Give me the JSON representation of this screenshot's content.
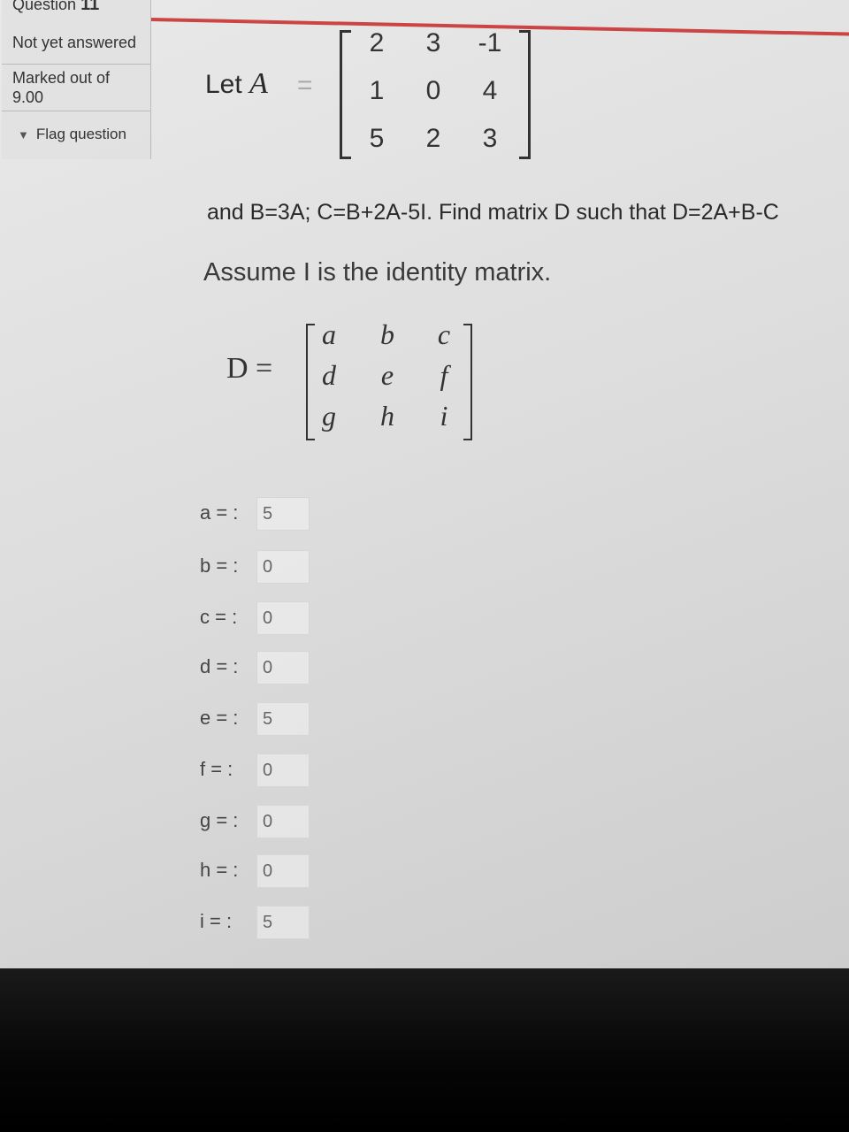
{
  "question_info": {
    "label": "Question",
    "number": "11",
    "status": "Not yet answered",
    "marked_out_of_label": "Marked out of",
    "marked_out_of_value": "9.00",
    "flag_label": "Flag question",
    "flag_icon": "flag-icon"
  },
  "question": {
    "let_text": "Let",
    "matrix_name": "A",
    "equals": "=",
    "matrix_a": [
      [
        "2",
        "3",
        "-1"
      ],
      [
        "1",
        "0",
        "4"
      ],
      [
        "5",
        "2",
        "3"
      ]
    ],
    "problem_text": "and B=3A; C=B+2A-5I. Find matrix D such that D=2A+B-C",
    "assumption": "Assume I is the identity matrix.",
    "d_label": "D =",
    "matrix_d": [
      [
        "a",
        "b",
        "c"
      ],
      [
        "d",
        "e",
        "f"
      ],
      [
        "g",
        "h",
        "i"
      ]
    ]
  },
  "answers": [
    {
      "label": "a = :",
      "value": "5"
    },
    {
      "label": "b = :",
      "value": "0"
    },
    {
      "label": "c = :",
      "value": "0"
    },
    {
      "label": "d = :",
      "value": "0"
    },
    {
      "label": "e = :",
      "value": "5"
    },
    {
      "label": "f = :",
      "value": "0"
    },
    {
      "label": "g = :",
      "value": "0"
    },
    {
      "label": "h = :",
      "value": "0"
    },
    {
      "label": "i = :",
      "value": "5"
    }
  ],
  "colors": {
    "page_background": "#dedede",
    "text": "#333333",
    "accent_line": "#cc4444"
  }
}
